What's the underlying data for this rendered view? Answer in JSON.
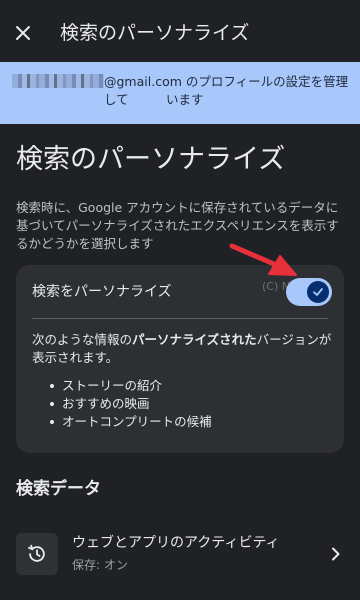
{
  "topbar": {
    "close_icon": "close-icon",
    "title": "検索のパーソナライズ"
  },
  "banner": {
    "email_suffix": "@gmail.com のプロフィールの設定を管理して",
    "line2": "います"
  },
  "page": {
    "title": "検索のパーソナライズ",
    "description": "検索時に、Google アカウントに保存されているデータに基づいてパーソナライズされたエクスペリエンスを表示するかどうかを選択します"
  },
  "card": {
    "toggle_label": "検索をパーソナライズ",
    "toggle_on": true,
    "watermark": "(C) Nicle",
    "intro_before": "次のような情報の",
    "intro_bold": "パーソナライズされた",
    "intro_after": "バージョンが表示されます。",
    "bullets": [
      "ストーリーの紹介",
      "おすすめの映画",
      "オートコンプリートの候補"
    ]
  },
  "section": {
    "title": "検索データ"
  },
  "activity": {
    "icon": "history-icon",
    "title": "ウェブとアプリのアクティビティ",
    "status": "保存: オン"
  },
  "colors": {
    "background": "#202124",
    "banner": "#a8c7fa",
    "card": "#2d2f33",
    "toggle_track": "#a8c7fa",
    "toggle_knob": "#062e6f",
    "annotation_arrow": "#e8303a"
  }
}
